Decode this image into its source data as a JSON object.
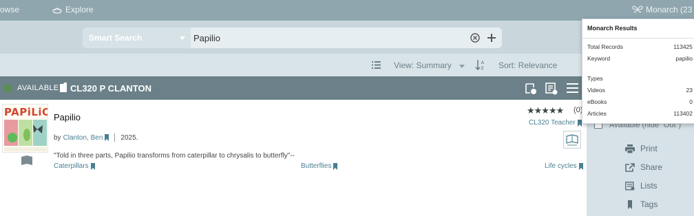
{
  "topbar": {
    "browse_label": "owse",
    "explore_label": "Explore",
    "monarch_label": "Monarch (23"
  },
  "search": {
    "type_label": "Smart Search",
    "query": "Papilio"
  },
  "sortbar": {
    "view_label": "View: Summary",
    "sort_label": "Sort: Relevance"
  },
  "item_header": {
    "status": "AVAILABLE",
    "call_number": "CL320 P CLANTON"
  },
  "result": {
    "cover_title": "PAPiLiO",
    "title": "Papilio",
    "by_prefix": "by",
    "author": "Clanton, Ben",
    "year": "2025.",
    "summary": "\"Told in three parts, Papilio transforms from caterpillar to chrysalis to butterfly\"--",
    "subjects": [
      "Caterpillars",
      "Butterflies",
      "Life cycles"
    ],
    "stars": "★★★★★",
    "rating_count": "(0)",
    "audience": "CL320 Teacher"
  },
  "sidebar": {
    "checkbox_label": "Available (hide \"Out\")",
    "actions": [
      "Print",
      "Share",
      "Lists",
      "Tags"
    ]
  },
  "popup": {
    "header": "Monarch Results",
    "total_label": "Total Records",
    "total_value": "113425",
    "keyword_label": "Keyword",
    "keyword_value": "papilio",
    "types_label": "Types",
    "types": [
      {
        "label": "Videos",
        "value": "23"
      },
      {
        "label": "eBooks",
        "value": "0"
      },
      {
        "label": "Articles",
        "value": "113402"
      }
    ]
  },
  "colors": {
    "topbar": "#8fa6ae",
    "search_band": "#c9d7dd",
    "item_header": "#6b8088",
    "link": "#4a7f91",
    "sidebar": "#d6e2e7"
  }
}
